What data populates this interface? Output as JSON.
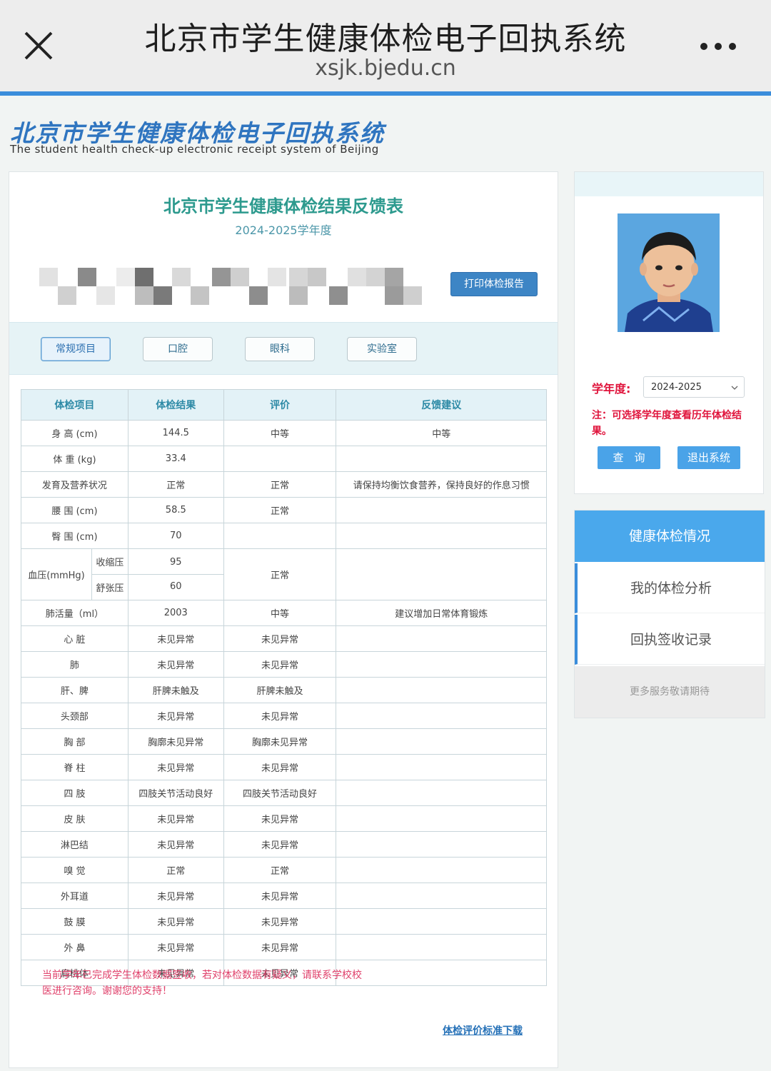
{
  "topbar": {
    "title": "北京市学生健康体检电子回执系统",
    "url": "xsjk.bjedu.cn"
  },
  "logo": {
    "title_cn": "北京市学生健康体检电子回执系统",
    "title_en": "The student health check-up electronic receipt system of Beijing"
  },
  "sheet": {
    "title": "北京市学生健康体检结果反馈表",
    "year": "2024-2025学年度",
    "print_label": "打印体检报告",
    "tabs": [
      "常规项目",
      "口腔",
      "眼科",
      "实验室"
    ],
    "headers": [
      "体检项目",
      "体检结果",
      "评价",
      "反馈建议"
    ],
    "rows": {
      "height": [
        "身 高 (cm)",
        "144.5",
        "中等",
        "中等"
      ],
      "weight": [
        "体 重 (kg)",
        "33.4",
        "",
        ""
      ],
      "nutrition": [
        "发育及营养状况",
        "正常",
        "正常",
        "请保持均衡饮食营养，保持良好的作息习惯"
      ],
      "waist": [
        "腰 围 (cm)",
        "58.5",
        "正常",
        ""
      ],
      "hip": [
        "臀 围 (cm)",
        "70",
        "",
        ""
      ],
      "bp": {
        "label": "血压(mmHg)",
        "systolic_label": "收缩压",
        "systolic": "95",
        "diastolic_label": "舒张压",
        "diastolic": "60",
        "eval": "正常",
        "advice": ""
      },
      "lung": [
        "肺活量（ml）",
        "2003",
        "中等",
        "建议增加日常体育锻炼"
      ],
      "heart": [
        "心 脏",
        "未见异常",
        "未见异常",
        ""
      ],
      "lungs": [
        "肺",
        "未见异常",
        "未见异常",
        ""
      ],
      "liver": [
        "肝、脾",
        "肝脾未触及",
        "肝脾未触及",
        ""
      ],
      "head": [
        "头颈部",
        "未见异常",
        "未见异常",
        ""
      ],
      "chest": [
        "胸 部",
        "胸廓未见异常",
        "胸廓未见异常",
        ""
      ],
      "spine": [
        "脊 柱",
        "未见异常",
        "未见异常",
        ""
      ],
      "limbs": [
        "四 肢",
        "四肢关节活动良好",
        "四肢关节活动良好",
        ""
      ],
      "skin": [
        "皮 肤",
        "未见异常",
        "未见异常",
        ""
      ],
      "lymph": [
        "淋巴结",
        "未见异常",
        "未见异常",
        ""
      ],
      "smell": [
        "嗅 觉",
        "正常",
        "正常",
        ""
      ],
      "ear": [
        "外耳道",
        "未见异常",
        "未见异常",
        ""
      ],
      "drum": [
        "鼓 膜",
        "未见异常",
        "未见异常",
        ""
      ],
      "nose": [
        "外 鼻",
        "未见异常",
        "未见异常",
        ""
      ],
      "tonsil": [
        "扁桃体",
        "未见异常",
        "未见异常",
        ""
      ]
    },
    "notice": "当前学年已完成学生体检数据签收，若对体检数据有疑义，请联系学校校医进行咨询。谢谢您的支持！",
    "download_link": "体检评价标准下载"
  },
  "sidebar": {
    "year_label": "学年度:",
    "year_value": "2024-2025",
    "note": "注：可选择学年度查看历年体检结果。",
    "query_label": "查　询",
    "logout_label": "退出系统",
    "menu": {
      "health": "健康体检情况",
      "analysis": "我的体检分析",
      "receipts": "回执签收记录",
      "more": "更多服务敬请期待"
    }
  },
  "colors": {
    "accent_blue": "#3a8ddb",
    "teal": "#2d9a8e",
    "warning_red": "#e0143c",
    "notice_pink": "#e0416b"
  }
}
